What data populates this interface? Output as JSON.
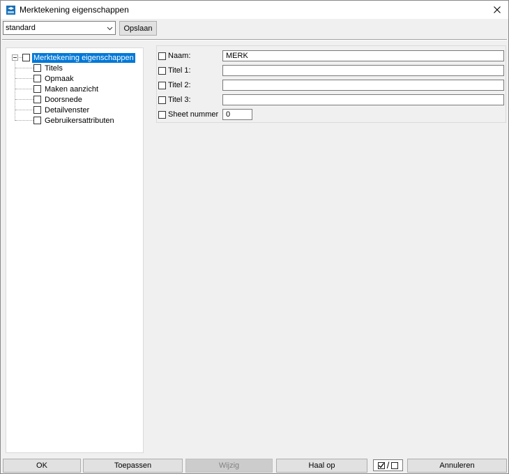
{
  "window": {
    "title": "Merktekening eigenschappen"
  },
  "toolbar": {
    "preset_value": "standard",
    "save_label": "Opslaan"
  },
  "tree": {
    "root_label": "Merktekening eigenschappen",
    "items": [
      "Titels",
      "Opmaak",
      "Maken aanzicht",
      "Doorsnede",
      "Detailvenster",
      "Gebruikersattributen"
    ]
  },
  "properties": [
    {
      "label": "Naam:",
      "value": "MERK"
    },
    {
      "label": "Titel 1:",
      "value": ""
    },
    {
      "label": "Titel 2:",
      "value": ""
    },
    {
      "label": "Titel 3:",
      "value": ""
    },
    {
      "label": "Sheet nummer",
      "value": "0"
    }
  ],
  "buttons": {
    "ok": "OK",
    "apply": "Toepassen",
    "modify": "Wijzig",
    "get": "Haal op",
    "cancel": "Annuleren",
    "toggle_separator": "/"
  },
  "colors": {
    "selection": "#0078d7",
    "dialog_bg": "#f0f0f0"
  }
}
